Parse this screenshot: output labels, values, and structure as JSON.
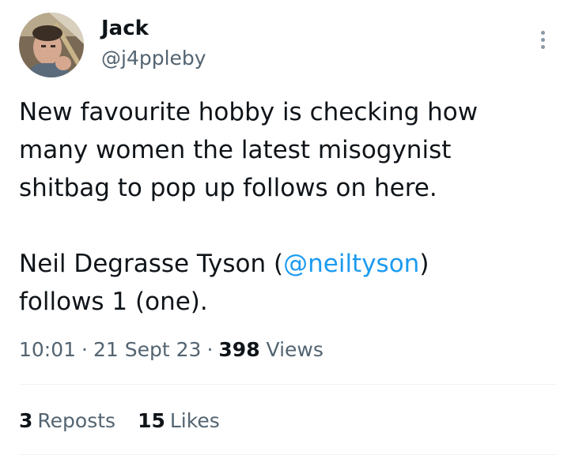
{
  "author": {
    "name": "Jack",
    "handle": "@j4ppleby",
    "avatar_icon": "user-photo-avatar"
  },
  "tweet": {
    "paragraphs": [
      [
        "New favourite hobby is checking how",
        "many women the latest misogynist",
        "shitbag to pop up follows on here."
      ],
      [
        "Neil Degrasse Tyson (",
        "@neiltyson",
        ")",
        "follows 1 (one)."
      ]
    ],
    "line1": "New favourite hobby is checking how",
    "line2": "many women the latest misogynist",
    "line3": "shitbag to pop up follows on here.",
    "line4_prefix": "Neil Degrasse Tyson (",
    "mention": "@neiltyson",
    "line4_suffix": ")",
    "line5": "follows 1 (one)."
  },
  "meta": {
    "time": "10:01",
    "separator": "·",
    "date": "21 Sept 23",
    "views_count": "398",
    "views_label": "Views"
  },
  "engagement": {
    "reposts_count": "3",
    "reposts_label": "Reposts",
    "likes_count": "15",
    "likes_label": "Likes"
  },
  "colors": {
    "text": "#0f1419",
    "secondary": "#536471",
    "link": "#1d9bf0",
    "divider": "#eff3f4"
  }
}
